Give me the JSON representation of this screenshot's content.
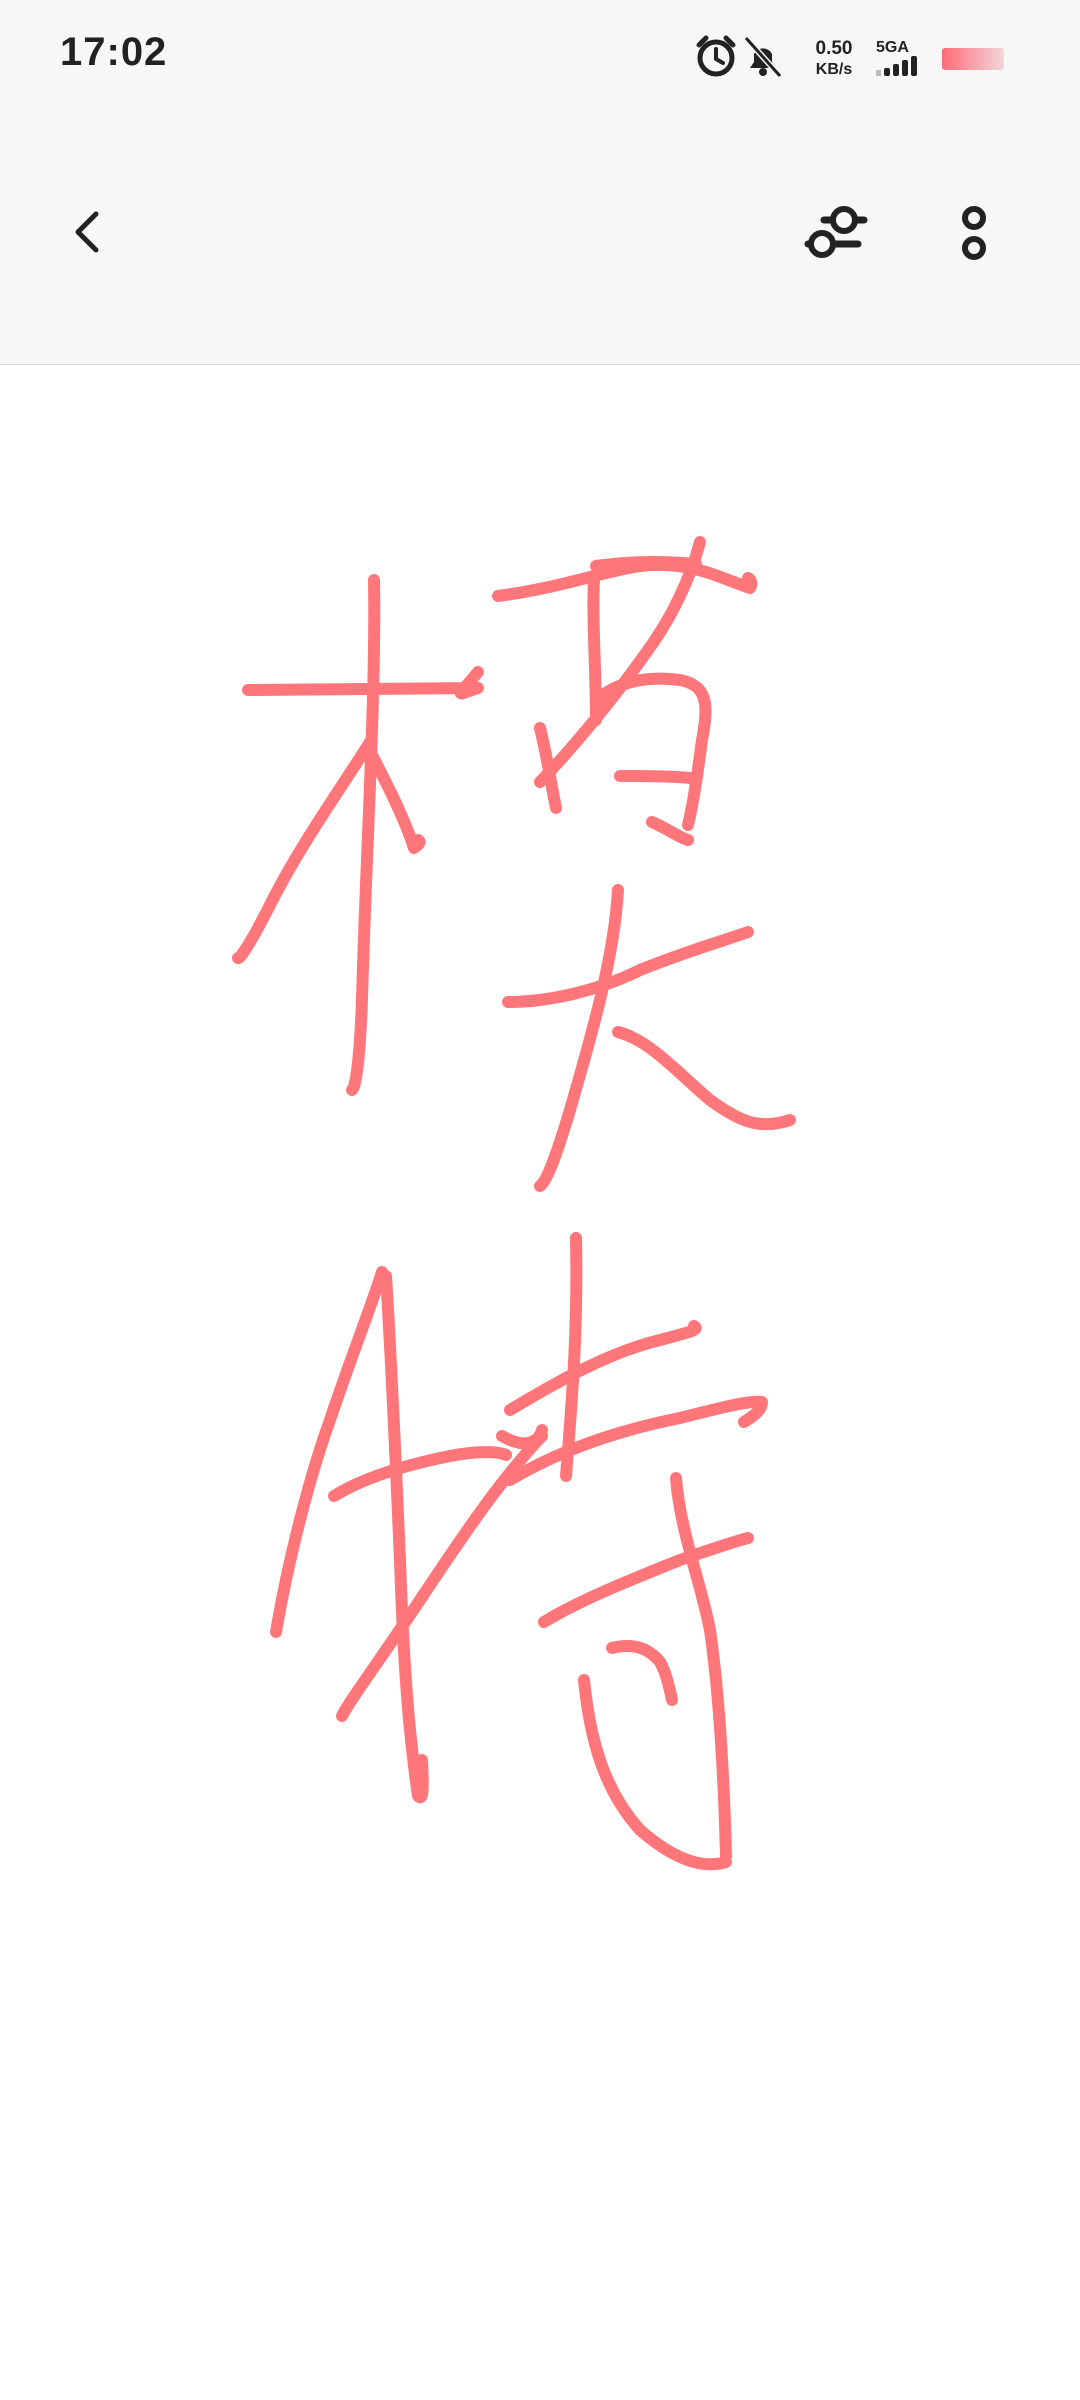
{
  "status_bar": {
    "time": "17:02",
    "net_speed_value": "0.50",
    "net_speed_unit": "KB/s",
    "network_type": "5GA",
    "icons": [
      "alarm-icon",
      "mute-bell-icon",
      "signal-icon",
      "battery-icon"
    ]
  },
  "toolbar": {
    "icons": [
      "back-arrow-icon",
      "adjust-settings-icon",
      "more-options-icon"
    ]
  },
  "drawing": {
    "stroke_color": "#ff6b6f",
    "content": "handwritten characters (模特)"
  }
}
